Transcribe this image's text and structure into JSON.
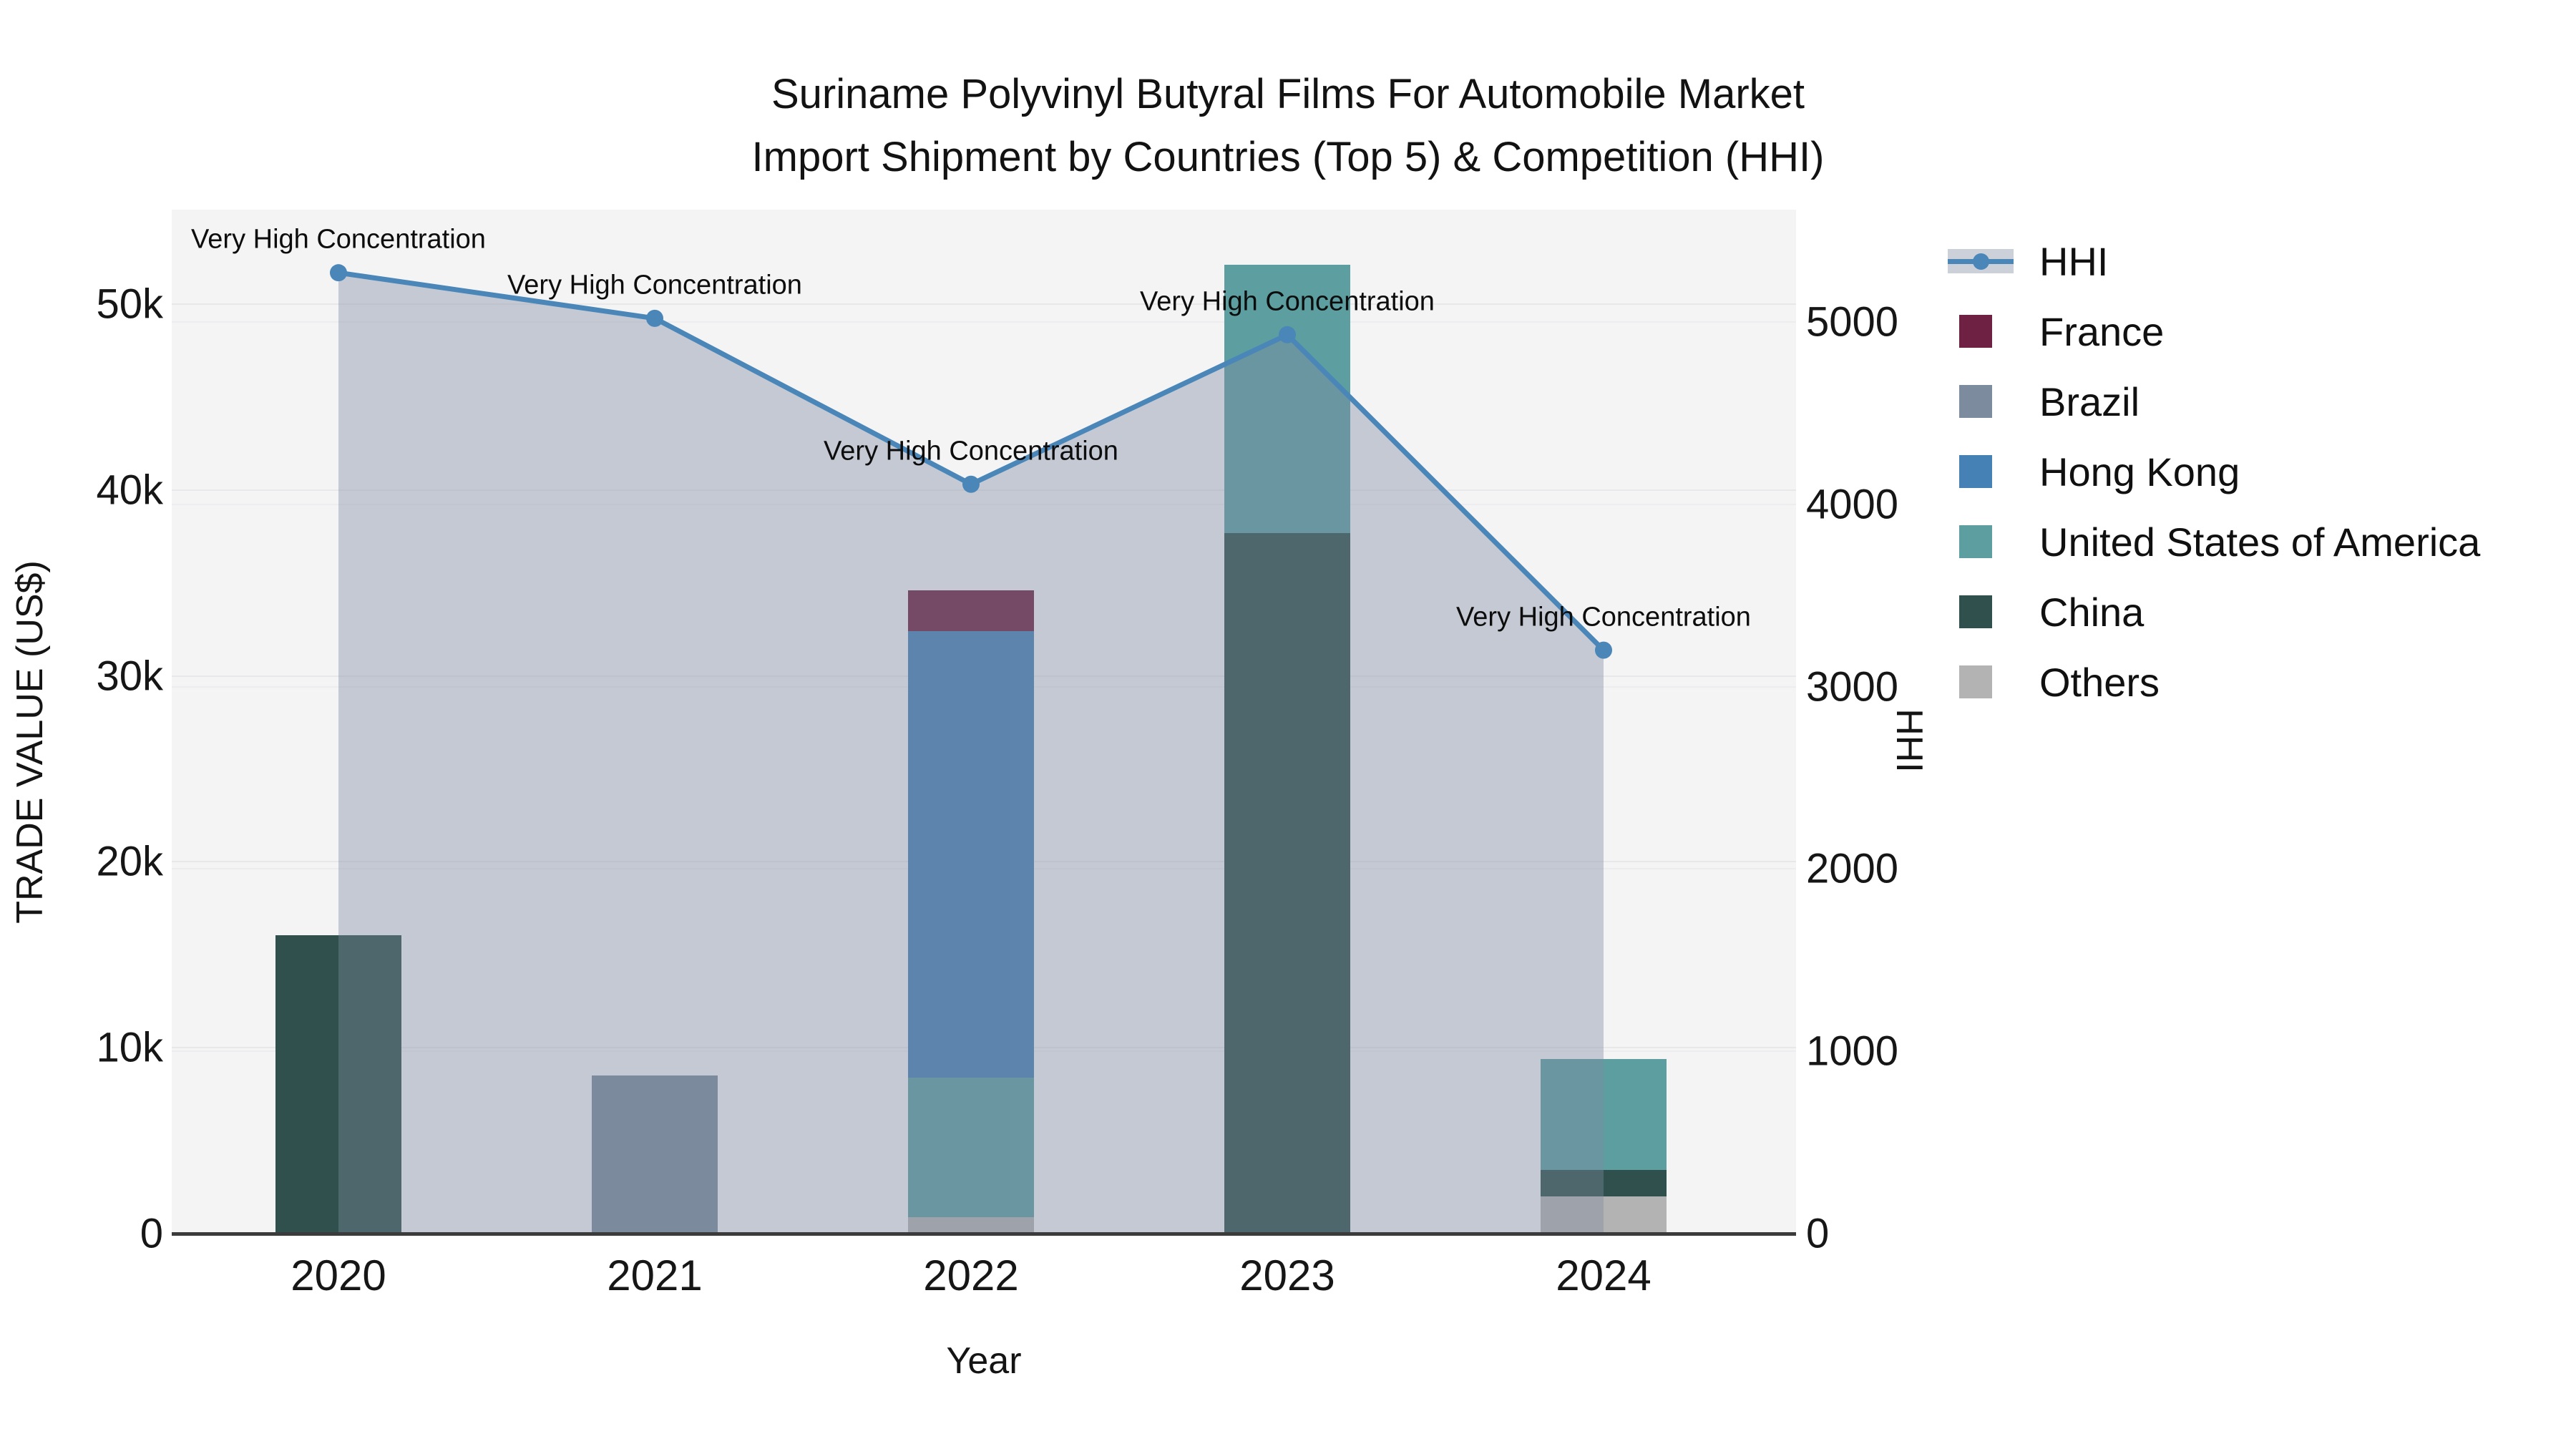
{
  "title": {
    "line1": "Suriname Polyvinyl Butyral Films For Automobile Market",
    "line2": "Import Shipment by Countries (Top 5) & Competition (HHI)"
  },
  "axes": {
    "x": {
      "title": "Year",
      "tick_labels": [
        "2020",
        "2021",
        "2022",
        "2023",
        "2024"
      ]
    },
    "y_left": {
      "title": "TRADE VALUE (US$)",
      "tick_labels": [
        "0",
        "10k",
        "20k",
        "30k",
        "40k",
        "50k"
      ],
      "tick_values": [
        0,
        10000,
        20000,
        30000,
        40000,
        50000
      ]
    },
    "y_right": {
      "title": "HHI",
      "tick_labels": [
        "0",
        "1000",
        "2000",
        "3000",
        "4000",
        "5000"
      ],
      "tick_values": [
        0,
        1000,
        2000,
        3000,
        4000,
        5000
      ]
    }
  },
  "legend": {
    "entries": [
      {
        "label": "HHI",
        "type": "line"
      },
      {
        "label": "France",
        "type": "swatch",
        "color": "#6e2142"
      },
      {
        "label": "Brazil",
        "type": "swatch",
        "color": "#7c8b9d"
      },
      {
        "label": "Hong Kong",
        "type": "swatch",
        "color": "#4681b5"
      },
      {
        "label": "United States of America",
        "type": "swatch",
        "color": "#5d9fa0"
      },
      {
        "label": "China",
        "type": "swatch",
        "color": "#2f504c"
      },
      {
        "label": "Others",
        "type": "swatch",
        "color": "#b3b3b3"
      }
    ]
  },
  "annotation_text": "Very High Concentration",
  "colors": {
    "hhi_line": "#4a86b8",
    "area_fill": "rgba(125,138,160,0.40)",
    "plot_background": "#f4f4f5",
    "axis_line": "#3b3b3b",
    "france": "#6e2142",
    "brazil": "#7c8b9d",
    "hong_kong": "#4681b5",
    "usa": "#5d9fa0",
    "china": "#2f504c",
    "others": "#b3b3b3"
  },
  "chart_data": {
    "type": "combo: stacked bar + line with area fill",
    "categories": [
      "2020",
      "2021",
      "2022",
      "2023",
      "2024"
    ],
    "bar_axis": "left",
    "bar_units": "TRADE VALUE (US$)",
    "series": [
      {
        "name": "France",
        "color": "#6e2142",
        "values": [
          0,
          0,
          2200,
          0,
          0
        ]
      },
      {
        "name": "Brazil",
        "color": "#7c8b9d",
        "values": [
          0,
          8500,
          0,
          0,
          0
        ]
      },
      {
        "name": "Hong Kong",
        "color": "#4681b5",
        "values": [
          0,
          0,
          24000,
          0,
          0
        ]
      },
      {
        "name": "United States of America",
        "color": "#5d9fa0",
        "values": [
          0,
          0,
          7500,
          14400,
          5960
        ]
      },
      {
        "name": "China",
        "color": "#2f504c",
        "values": [
          16050,
          0,
          0,
          37700,
          1430
        ]
      },
      {
        "name": "Others",
        "color": "#b3b3b3",
        "values": [
          0,
          0,
          900,
          0,
          2000
        ]
      }
    ],
    "stack_order_top_to_bottom": [
      "France",
      "Brazil",
      "Hong Kong",
      "United States of America",
      "China",
      "Others"
    ],
    "line_series": {
      "name": "HHI",
      "axis": "right",
      "color": "#4a86b8",
      "values": [
        5270,
        5020,
        4110,
        4930,
        3200
      ],
      "annotations": [
        "Very High Concentration",
        "Very High Concentration",
        "Very High Concentration",
        "Very High Concentration",
        "Very High Concentration"
      ]
    },
    "ylim_left": [
      0,
      55000
    ],
    "ylim_right": [
      0,
      5600
    ],
    "grid": "horizontal, both axes",
    "legend_position": "top-right outside plot"
  }
}
